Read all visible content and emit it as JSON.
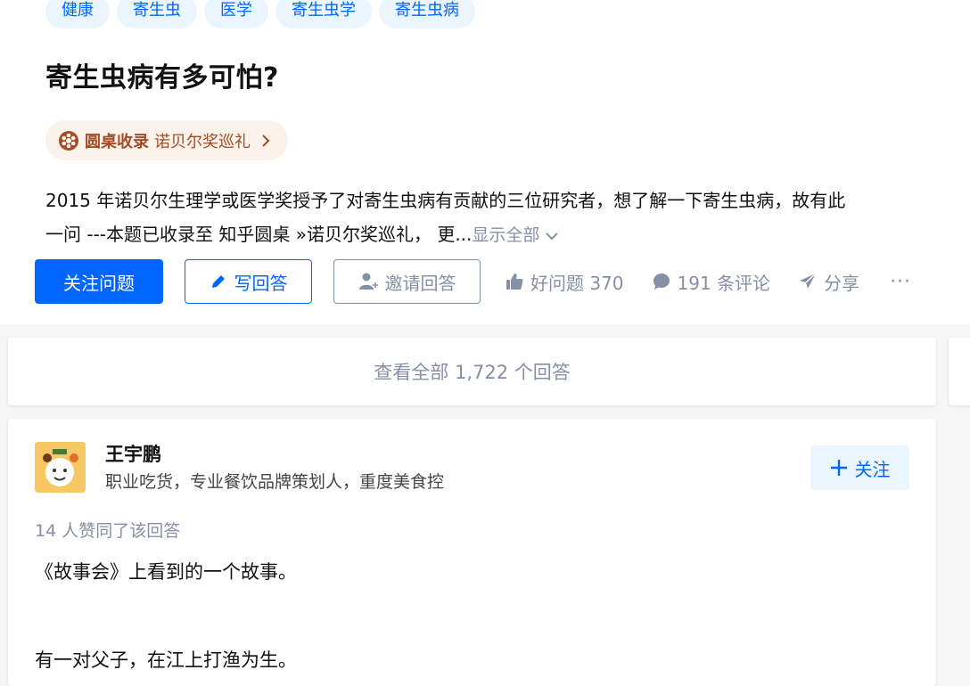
{
  "question": {
    "topics": [
      "健康",
      "寄生虫",
      "医学",
      "寄生虫学",
      "寄生虫病"
    ],
    "title": "寄生虫病有多可怕?",
    "roundtable": {
      "label": "圆桌收录",
      "name": "诺贝尔奖巡礼"
    },
    "description_line1": "2015 年诺贝尔生理学或医学奖授予了对寄生虫病有贡献的三位研究者，想了解一下寄生虫病，故有此",
    "description_line2": "一问 ---本题已收录至 知乎圆桌 »诺贝尔奖巡礼，  更...",
    "show_all": "显示全部"
  },
  "actions": {
    "follow": "关注问题",
    "write": "写回答",
    "invite": "邀请回答",
    "good_question": "好问题 370",
    "comments": "191 条评论",
    "share": "分享",
    "more": "···"
  },
  "view_all": "查看全部 1,722 个回答",
  "answer": {
    "author_name": "王宇鹏",
    "author_bio": "职业吃货，专业餐饮品牌策划人，重度美食控",
    "follow": "关注",
    "votes": "14 人赞同了该回答",
    "paragraphs": [
      "《故事会》上看到的一个故事。",
      "有一对父子，在江上打渔为生。"
    ]
  },
  "colors": {
    "brand": "#0066ff",
    "muted": "#8590a6",
    "roundtable": "#a24d24"
  }
}
